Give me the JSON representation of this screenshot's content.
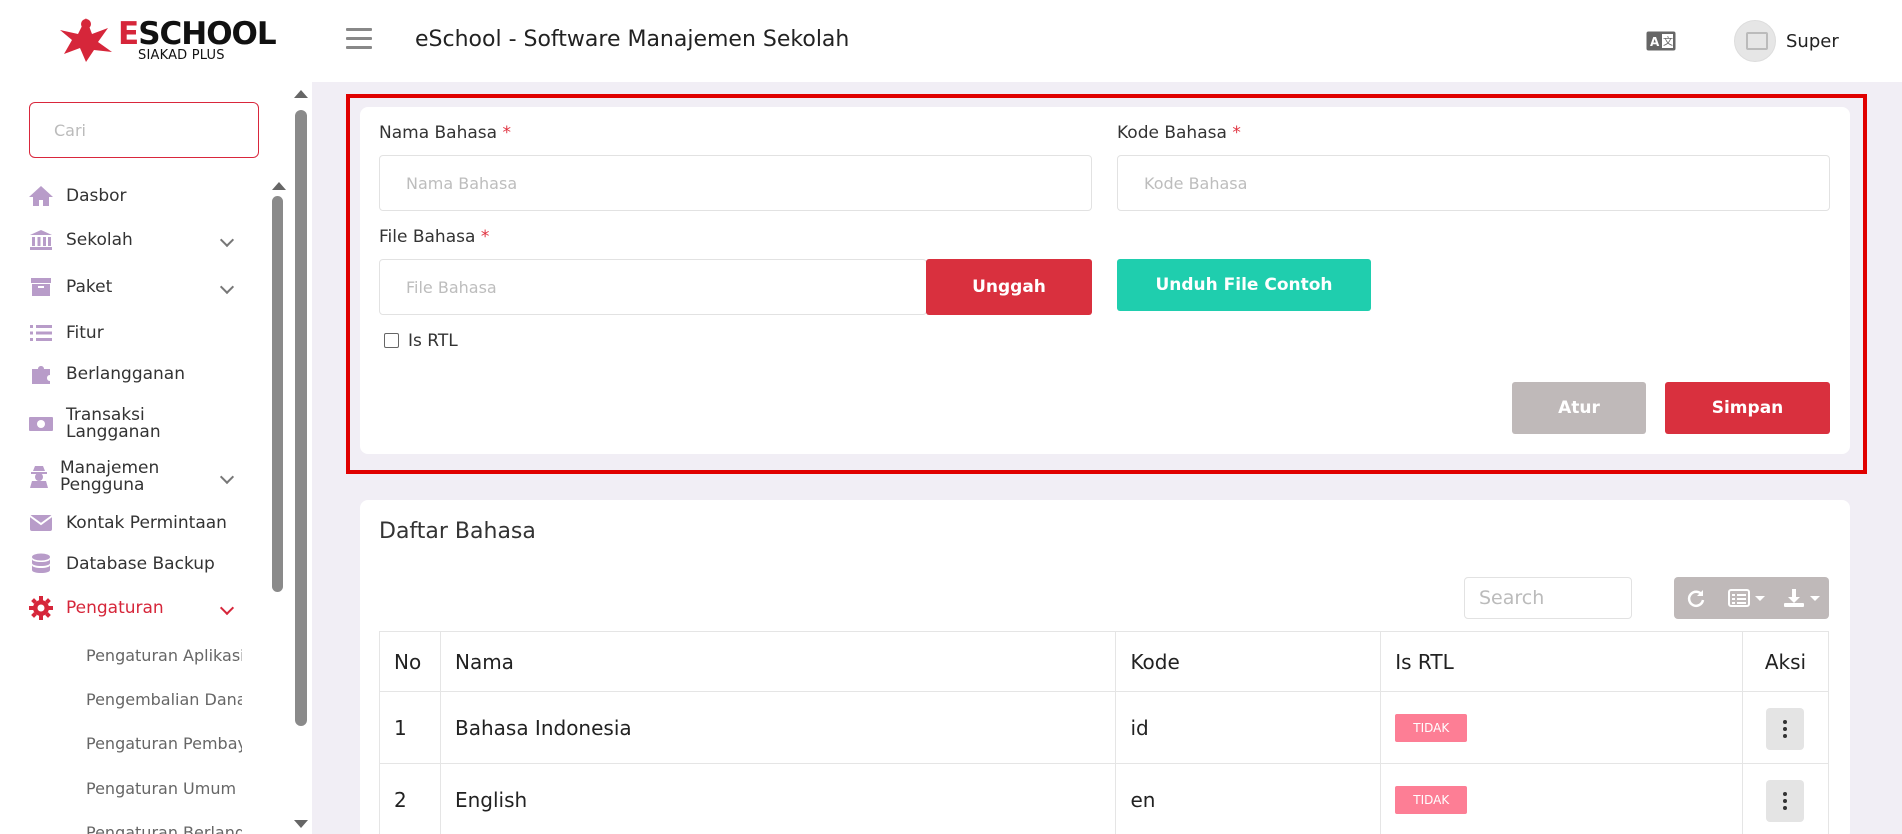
{
  "header": {
    "logo_main": "ESCHOOL",
    "logo_sub": "SIAKAD PLUS",
    "app_title": "eSchool - Software Manajemen Sekolah",
    "user_name": "Super"
  },
  "sidebar": {
    "search_placeholder": "Cari",
    "items": [
      {
        "label": "Dasbor",
        "icon": "home-icon"
      },
      {
        "label": "Sekolah",
        "icon": "institution-icon"
      },
      {
        "label": "Paket",
        "icon": "box-icon"
      },
      {
        "label": "Fitur",
        "icon": "list-icon"
      },
      {
        "label": "Berlangganan",
        "icon": "puzzle-icon"
      },
      {
        "label": "Transaksi Langganan",
        "icon": "money-icon"
      },
      {
        "label": "Manajemen Pengguna",
        "icon": "user-secret-icon"
      },
      {
        "label": "Kontak Permintaan",
        "icon": "envelope-icon"
      },
      {
        "label": "Database Backup",
        "icon": "database-icon"
      },
      {
        "label": "Pengaturan",
        "icon": "gear-icon"
      }
    ],
    "sub_items": [
      "Pengaturan Aplikasi",
      "Pengembalian Dana",
      "Pengaturan Pembayaran",
      "Pengaturan Umum",
      "Pengaturan Berlangganan"
    ]
  },
  "form": {
    "name_label": "Nama Bahasa",
    "name_placeholder": "Nama Bahasa",
    "code_label": "Kode Bahasa",
    "code_placeholder": "Kode Bahasa",
    "file_label": "File Bahasa",
    "file_placeholder": "File Bahasa",
    "required_mark": "*",
    "upload_button": "Unggah",
    "download_sample_button": "Unduh File Contoh",
    "rtl_label": "Is RTL",
    "reset_button": "Atur",
    "save_button": "Simpan"
  },
  "list": {
    "title": "Daftar Bahasa",
    "search_placeholder": "Search",
    "columns": [
      "No",
      "Nama",
      "Kode",
      "Is RTL",
      "Aksi"
    ],
    "rows": [
      {
        "no": "1",
        "name": "Bahasa Indonesia",
        "code": "id",
        "rtl": "TIDAK"
      },
      {
        "no": "2",
        "name": "English",
        "code": "en",
        "rtl": "TIDAK"
      }
    ]
  },
  "colors": {
    "accent": "#d6263a",
    "teal": "#1fceae",
    "grey_button": "#bfb9b9",
    "badge": "#fd7e95",
    "highlight": "#e00000"
  }
}
